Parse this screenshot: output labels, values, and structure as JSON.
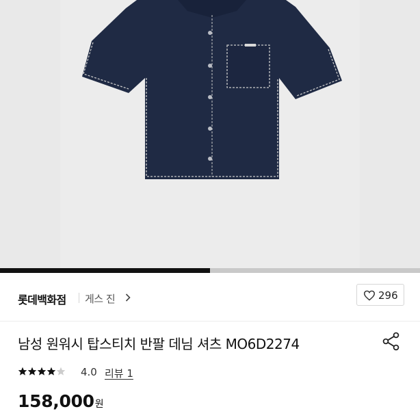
{
  "gallery": {
    "image_alt": "product-photo-denim-short-sleeve-shirt",
    "slide_progress": 0.5,
    "background_color": "#e9e9e9",
    "garment_color": "#1f2a44",
    "stitch_color": "#c9c9c9"
  },
  "store": {
    "name": "롯데백화점",
    "brand": "게스 진"
  },
  "like": {
    "count": "296",
    "icon": "heart-outline-icon"
  },
  "product": {
    "title": "남성 원워시 탑스티치 반팔 데님 셔츠 MO6D2274",
    "share_icon": "share-icon"
  },
  "rating": {
    "stars_filled": 4,
    "stars_total": 5,
    "value": "4.0",
    "review_label": "리뷰 1"
  },
  "price": {
    "amount": "158,000",
    "currency": "원"
  },
  "colors": {
    "accent": "#111111",
    "star": "#111111",
    "star_empty": "#cccccc",
    "progress_track": "#c9c9c9"
  }
}
